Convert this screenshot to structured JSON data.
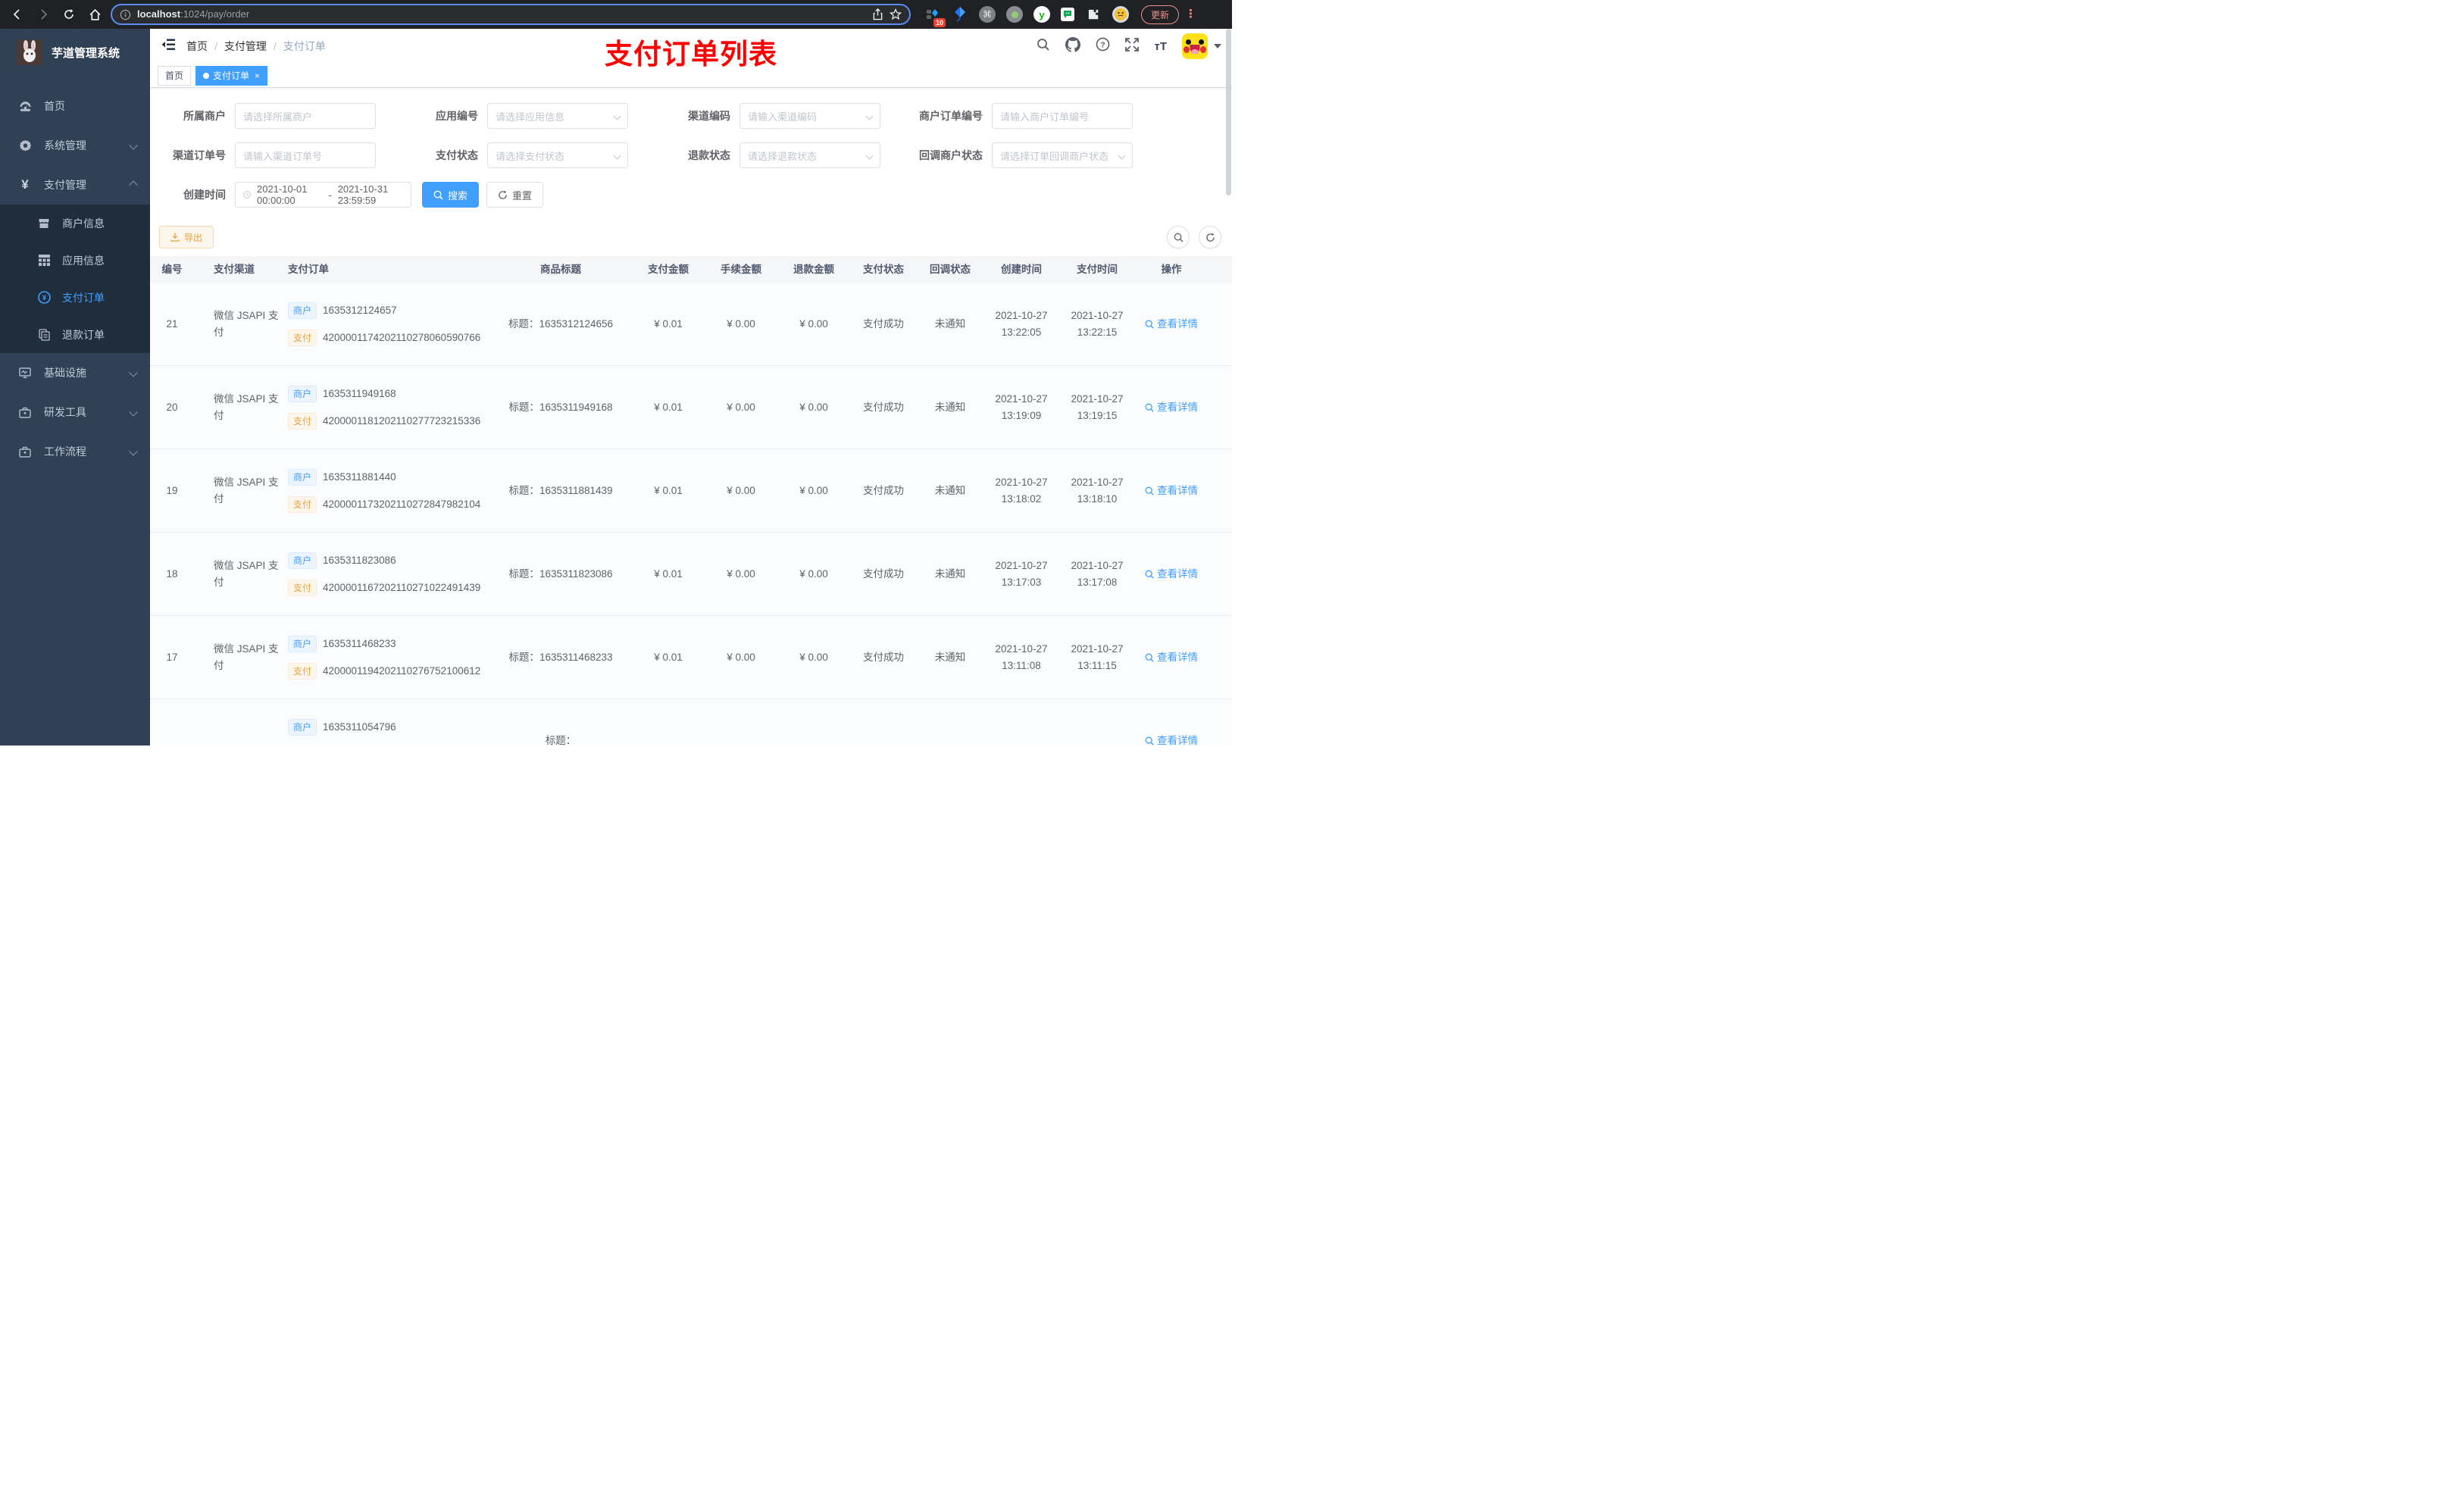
{
  "browser": {
    "url_host": "localhost",
    "url_path": ":1024/pay/order",
    "extension_badge": "10",
    "update_label": "更新"
  },
  "sidebar": {
    "logo_title": "芋道管理系统",
    "items": [
      {
        "label": "首页"
      },
      {
        "label": "系统管理"
      },
      {
        "label": "支付管理"
      }
    ],
    "submenu": [
      {
        "label": "商户信息"
      },
      {
        "label": "应用信息"
      },
      {
        "label": "支付订单"
      },
      {
        "label": "退款订单"
      }
    ],
    "items_bottom": [
      {
        "label": "基础设施"
      },
      {
        "label": "研发工具"
      },
      {
        "label": "工作流程"
      }
    ]
  },
  "header": {
    "breadcrumb": [
      "首页",
      "支付管理",
      "支付订单"
    ],
    "annotation": "支付订单列表"
  },
  "tags": {
    "home": "首页",
    "active": "支付订单",
    "close": "×"
  },
  "filters": {
    "merchant_label": "所属商户",
    "merchant_placeholder": "请选择所属商户",
    "app_label": "应用编号",
    "app_placeholder": "请选择应用信息",
    "channel_code_label": "渠道编码",
    "channel_code_placeholder": "请输入渠道编码",
    "merchant_order_label": "商户订单编号",
    "merchant_order_placeholder": "请输入商户订单编号",
    "channel_order_label": "渠道订单号",
    "channel_order_placeholder": "请输入渠道订单号",
    "pay_status_label": "支付状态",
    "pay_status_placeholder": "请选择支付状态",
    "refund_status_label": "退款状态",
    "refund_status_placeholder": "请选择退款状态",
    "notify_status_label": "回调商户状态",
    "notify_status_placeholder": "请选择订单回调商户状态",
    "create_time_label": "创建时间",
    "date_start": "2021-10-01 00:00:00",
    "date_separator": "-",
    "date_end": "2021-10-31 23:59:59",
    "search_label": "搜索",
    "reset_label": "重置"
  },
  "toolbar": {
    "export_label": "导出"
  },
  "table": {
    "columns": {
      "id": "编号",
      "channel": "支付渠道",
      "order": "支付订单",
      "title": "商品标题",
      "amount": "支付金额",
      "fee": "手续金额",
      "refund": "退款金额",
      "status": "支付状态",
      "notify": "回调状态",
      "create": "创建时间",
      "pay": "支付时间",
      "action": "操作"
    },
    "merchant_tag": "商户",
    "pay_tag": "支付",
    "title_prefix": "标题：",
    "action_label": "查看详情",
    "rows": [
      {
        "id": "21",
        "channel": "微信 JSAPI 支付",
        "merchant_no": "1635312124657",
        "channel_no": "4200001174202110278060590766",
        "title": "1635312124656",
        "amount": "¥ 0.01",
        "fee": "¥ 0.00",
        "refund": "¥ 0.00",
        "status": "支付成功",
        "notify": "未通知",
        "create_date": "2021-10-27",
        "create_time": "13:22:05",
        "pay_date": "2021-10-27",
        "pay_time": "13:22:15"
      },
      {
        "id": "20",
        "channel": "微信 JSAPI 支付",
        "merchant_no": "1635311949168",
        "channel_no": "4200001181202110277723215336",
        "title": "1635311949168",
        "amount": "¥ 0.01",
        "fee": "¥ 0.00",
        "refund": "¥ 0.00",
        "status": "支付成功",
        "notify": "未通知",
        "create_date": "2021-10-27",
        "create_time": "13:19:09",
        "pay_date": "2021-10-27",
        "pay_time": "13:19:15"
      },
      {
        "id": "19",
        "channel": "微信 JSAPI 支付",
        "merchant_no": "1635311881440",
        "channel_no": "4200001173202110272847982104",
        "title": "1635311881439",
        "amount": "¥ 0.01",
        "fee": "¥ 0.00",
        "refund": "¥ 0.00",
        "status": "支付成功",
        "notify": "未通知",
        "create_date": "2021-10-27",
        "create_time": "13:18:02",
        "pay_date": "2021-10-27",
        "pay_time": "13:18:10"
      },
      {
        "id": "18",
        "channel": "微信 JSAPI 支付",
        "merchant_no": "1635311823086",
        "channel_no": "4200001167202110271022491439",
        "title": "1635311823086",
        "amount": "¥ 0.01",
        "fee": "¥ 0.00",
        "refund": "¥ 0.00",
        "status": "支付成功",
        "notify": "未通知",
        "create_date": "2021-10-27",
        "create_time": "13:17:03",
        "pay_date": "2021-10-27",
        "pay_time": "13:17:08"
      },
      {
        "id": "17",
        "channel": "微信 JSAPI 支付",
        "merchant_no": "1635311468233",
        "channel_no": "4200001194202110276752100612",
        "title": "1635311468233",
        "amount": "¥ 0.01",
        "fee": "¥ 0.00",
        "refund": "¥ 0.00",
        "status": "支付成功",
        "notify": "未通知",
        "create_date": "2021-10-27",
        "create_time": "13:11:08",
        "pay_date": "2021-10-27",
        "pay_time": "13:11:15"
      },
      {
        "id": "",
        "channel": "",
        "merchant_no": "1635311054796",
        "channel_no": "",
        "title": "",
        "amount": "",
        "fee": "",
        "refund": "",
        "status": "",
        "notify": "",
        "create_date": "",
        "create_time": "",
        "pay_date": "",
        "pay_time": ""
      }
    ]
  }
}
